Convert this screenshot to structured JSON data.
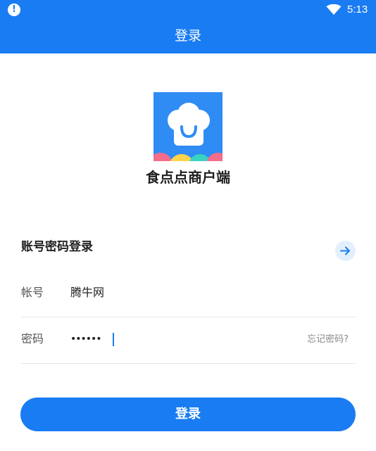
{
  "status_bar": {
    "time": "5:13",
    "alert_icon": "alert-icon",
    "wifi_icon": "wifi-icon"
  },
  "app_bar": {
    "title": "登录"
  },
  "app": {
    "name": "食点点商户端",
    "logo_icon": "chef-hat-logo"
  },
  "login": {
    "section_title": "账号密码登录",
    "switch_icon": "arrow-right-icon",
    "account": {
      "label": "帐号",
      "value": "腾牛网"
    },
    "password": {
      "label": "密码",
      "masked_value": "••••••",
      "forgot_label": "忘记密码?"
    },
    "submit_label": "登录"
  },
  "colors": {
    "primary": "#1a7cf2",
    "logo_bg": "#2f8cf4",
    "switch_bg": "#e3effd",
    "divider": "#e6e6e6"
  }
}
